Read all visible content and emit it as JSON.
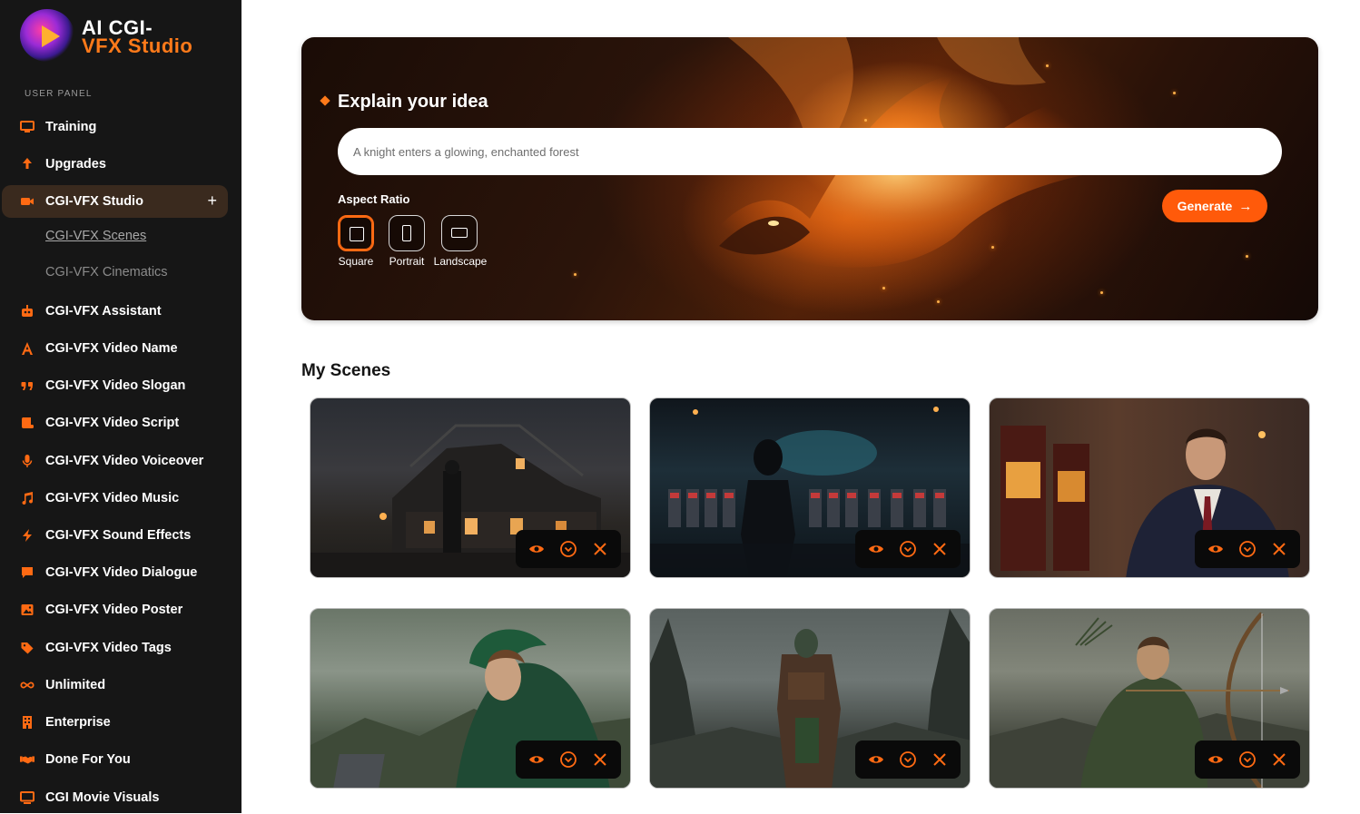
{
  "brand": {
    "line1": "AI CGI-",
    "line2": "VFX Studio"
  },
  "sidebar": {
    "section_label": "USER PANEL",
    "items": [
      {
        "label": "Training",
        "icon": "training-icon"
      },
      {
        "label": "Upgrades",
        "icon": "upgrade-arrow-icon"
      },
      {
        "label": "CGI-VFX Studio",
        "icon": "video-camera-icon",
        "active": true
      },
      {
        "label": "CGI-VFX Assistant",
        "icon": "robot-icon"
      },
      {
        "label": "CGI-VFX Video Name",
        "icon": "letter-a-icon"
      },
      {
        "label": "CGI-VFX Video Slogan",
        "icon": "quote-icon"
      },
      {
        "label": "CGI-VFX Video Script",
        "icon": "script-icon"
      },
      {
        "label": "CGI-VFX Video Voiceover",
        "icon": "microphone-icon"
      },
      {
        "label": "CGI-VFX Video Music",
        "icon": "music-note-icon"
      },
      {
        "label": "CGI-VFX Sound Effects",
        "icon": "lightning-icon"
      },
      {
        "label": "CGI-VFX Video Dialogue",
        "icon": "chat-bubble-icon"
      },
      {
        "label": "CGI-VFX Video Poster",
        "icon": "image-icon"
      },
      {
        "label": "CGI-VFX Video Tags",
        "icon": "tag-icon"
      },
      {
        "label": "Unlimited",
        "icon": "infinity-icon"
      },
      {
        "label": "Enterprise",
        "icon": "building-icon"
      },
      {
        "label": "Done For You",
        "icon": "handshake-icon"
      },
      {
        "label": "CGI Movie Visuals",
        "icon": "monitor-icon"
      }
    ],
    "sub_items": [
      {
        "label": "CGI-VFX Scenes",
        "current": true
      },
      {
        "label": "CGI-VFX Cinematics",
        "current": false
      }
    ]
  },
  "hero": {
    "title": "Explain your idea",
    "input_placeholder": "A knight enters a glowing, enchanted forest",
    "aspect_label": "Aspect Ratio",
    "aspect_options": [
      {
        "label": "Square",
        "selected": true
      },
      {
        "label": "Portrait",
        "selected": false
      },
      {
        "label": "Landscape",
        "selected": false
      }
    ],
    "generate_label": "Generate"
  },
  "scenes": {
    "title": "My Scenes",
    "cards": [
      {
        "scene": "haunted-house-night"
      },
      {
        "scene": "robot-casino"
      },
      {
        "scene": "man-in-suit-casino"
      },
      {
        "scene": "hooded-archer-laptop"
      },
      {
        "scene": "armored-warrior-cliffs"
      },
      {
        "scene": "archer-drawing-bow"
      }
    ]
  },
  "colors": {
    "accent": "#ff6a13",
    "sidebar_bg": "#161616",
    "active_bg": "#3a2a1e"
  }
}
